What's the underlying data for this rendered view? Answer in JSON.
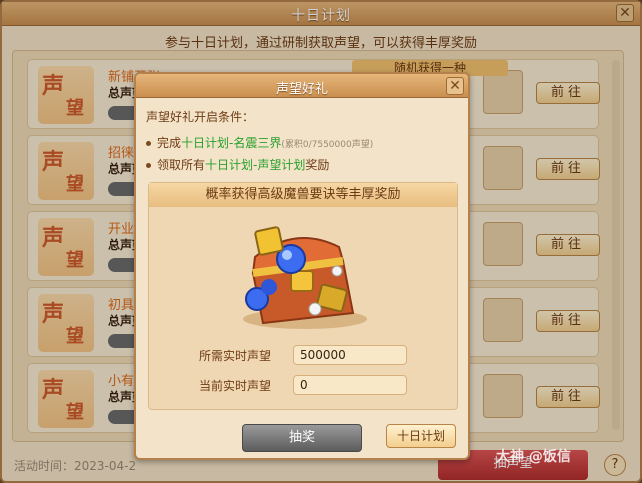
{
  "window": {
    "title": "十日计划",
    "subtitle": "参与十日计划，通过研制获取声望，可以获得丰厚奖励",
    "random_tag": "随机获得一种"
  },
  "rows": [
    {
      "badge_1": "声",
      "badge_2": "望",
      "title": "新铺开张",
      "sub": "总声望",
      "button": "前往"
    },
    {
      "badge_1": "声",
      "badge_2": "望",
      "title": "招徕顾",
      "sub": "总声望",
      "button": "前往"
    },
    {
      "badge_1": "声",
      "badge_2": "望",
      "title": "开业大",
      "sub": "总声望",
      "button": "前往"
    },
    {
      "badge_1": "声",
      "badge_2": "望",
      "title": "初具规",
      "sub": "总声望",
      "button": "前往"
    },
    {
      "badge_1": "声",
      "badge_2": "望",
      "title": "小有名",
      "sub": "总声望",
      "button": "前往"
    }
  ],
  "footer": {
    "time_label": "活动时间：2023-04-2",
    "draw_button": "抽声望",
    "help": "?"
  },
  "modal": {
    "title": "声望好礼",
    "conditions_title": "声望好礼开启条件：",
    "cond1_prefix": "完成",
    "cond1_highlight": "十日计划-名震三界",
    "cond1_note": "(累积0/7550000声望)",
    "cond2_prefix": "领取所有",
    "cond2_highlight": "十日计划-声望计划",
    "cond2_suffix": "奖励",
    "inner_header": "概率获得高级魔兽要诀等丰厚奖励",
    "required_label": "所需实时声望",
    "required_value": "500000",
    "current_label": "当前实时声望",
    "current_value": "0",
    "draw_button": "抽奖",
    "plan_button": "十日计划"
  },
  "watermark": "大神 @饭信",
  "colors": {
    "accent_orange": "#e06b1a",
    "highlight_green": "#27a02c",
    "title_bar": "#c98f4f"
  }
}
